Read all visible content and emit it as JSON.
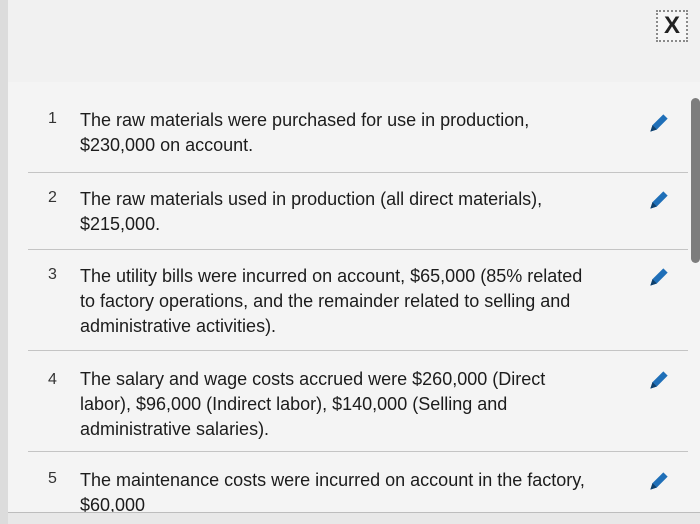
{
  "close": {
    "label": "X"
  },
  "items": [
    {
      "number": "1",
      "text": "The raw materials were purchased for use in production, $230,000 on account."
    },
    {
      "number": "2",
      "text": "The raw materials used in production (all direct materials), $215,000."
    },
    {
      "number": "3",
      "text": "The utility bills were incurred on account, $65,000 (85% related to factory operations, and the remainder related to selling and administrative activities)."
    },
    {
      "number": "4",
      "text": "The salary and wage costs accrued were $260,000 (Direct labor), $96,000 (Indirect labor), $140,000 (Selling and administrative salaries)."
    },
    {
      "number": "5",
      "text": "The maintenance costs were incurred on account in the factory, $60,000"
    }
  ],
  "icons": {
    "edit": "pencil-icon",
    "close": "close-icon"
  },
  "colors": {
    "pencil": "#1f6fb8",
    "background": "#f4f4f4"
  }
}
